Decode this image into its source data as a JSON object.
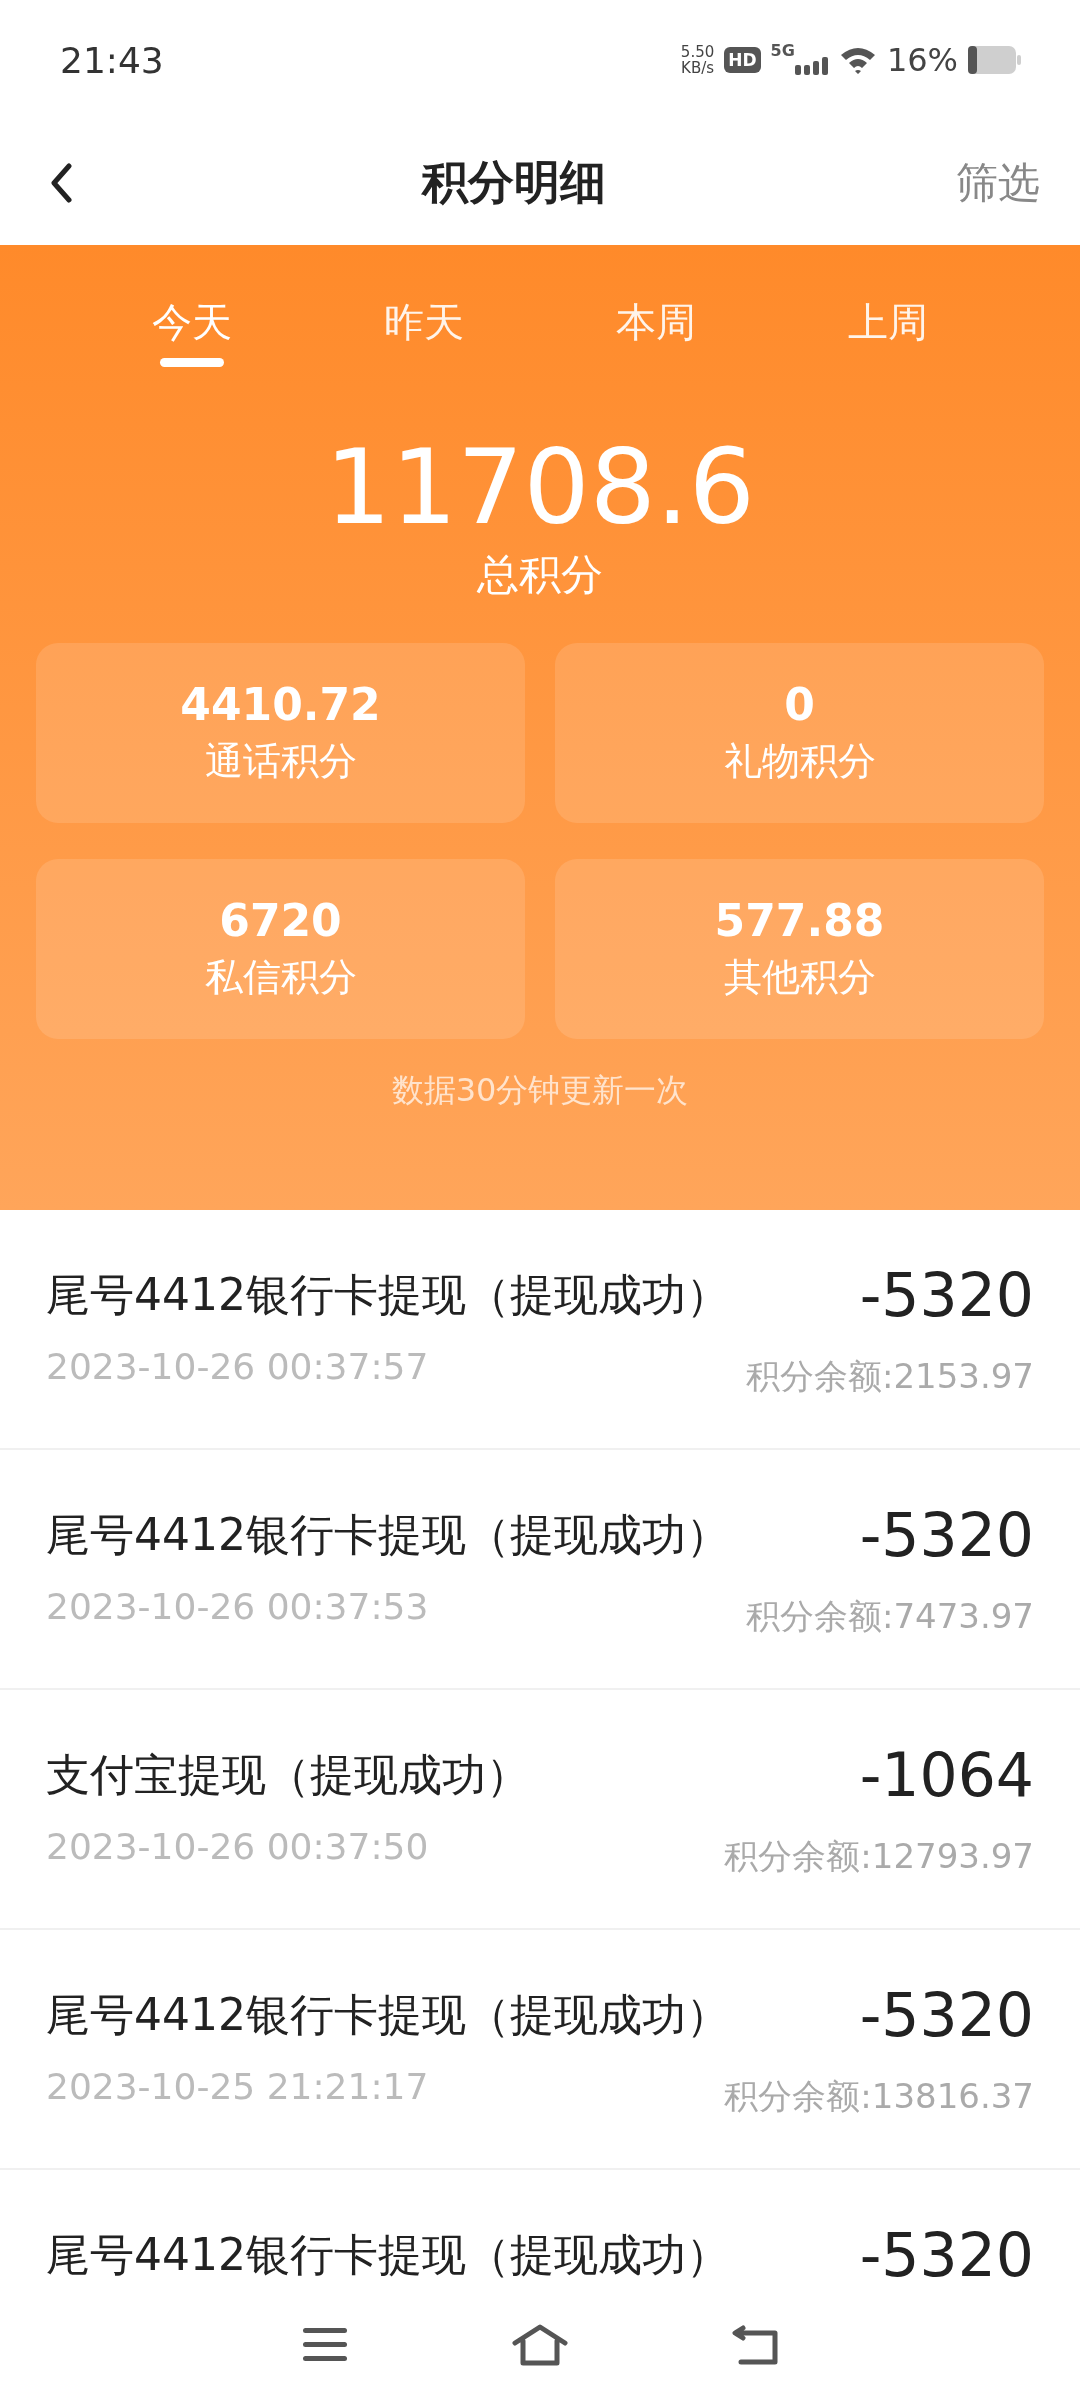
{
  "status_bar": {
    "time": "21:43",
    "speed_value": "5.50",
    "speed_unit": "KB/s",
    "hd": "HD",
    "network": "5G",
    "battery": "16%"
  },
  "header": {
    "title": "积分明细",
    "action": "筛选"
  },
  "tabs": [
    {
      "label": "今天",
      "selected": true
    },
    {
      "label": "昨天",
      "selected": false
    },
    {
      "label": "本周",
      "selected": false
    },
    {
      "label": "上周",
      "selected": false
    }
  ],
  "total": {
    "value": "11708.6",
    "label": "总积分"
  },
  "stats": [
    {
      "value": "4410.72",
      "label": "通话积分"
    },
    {
      "value": "0",
      "label": "礼物积分"
    },
    {
      "value": "6720",
      "label": "私信积分"
    },
    {
      "value": "577.88",
      "label": "其他积分"
    }
  ],
  "note": "数据30分钟更新一次",
  "records": [
    {
      "title": "尾号4412银行卡提现（提现成功）",
      "amount": "-5320",
      "time": "2023-10-26 00:37:57",
      "balance": "积分余额:2153.97"
    },
    {
      "title": "尾号4412银行卡提现（提现成功）",
      "amount": "-5320",
      "time": "2023-10-26 00:37:53",
      "balance": "积分余额:7473.97"
    },
    {
      "title": "支付宝提现（提现成功）",
      "amount": "-1064",
      "time": "2023-10-26 00:37:50",
      "balance": "积分余额:12793.97"
    },
    {
      "title": "尾号4412银行卡提现（提现成功）",
      "amount": "-5320",
      "time": "2023-10-25 21:21:17",
      "balance": "积分余额:13816.37"
    },
    {
      "title": "尾号4412银行卡提现（提现成功）",
      "amount": "-5320"
    }
  ]
}
